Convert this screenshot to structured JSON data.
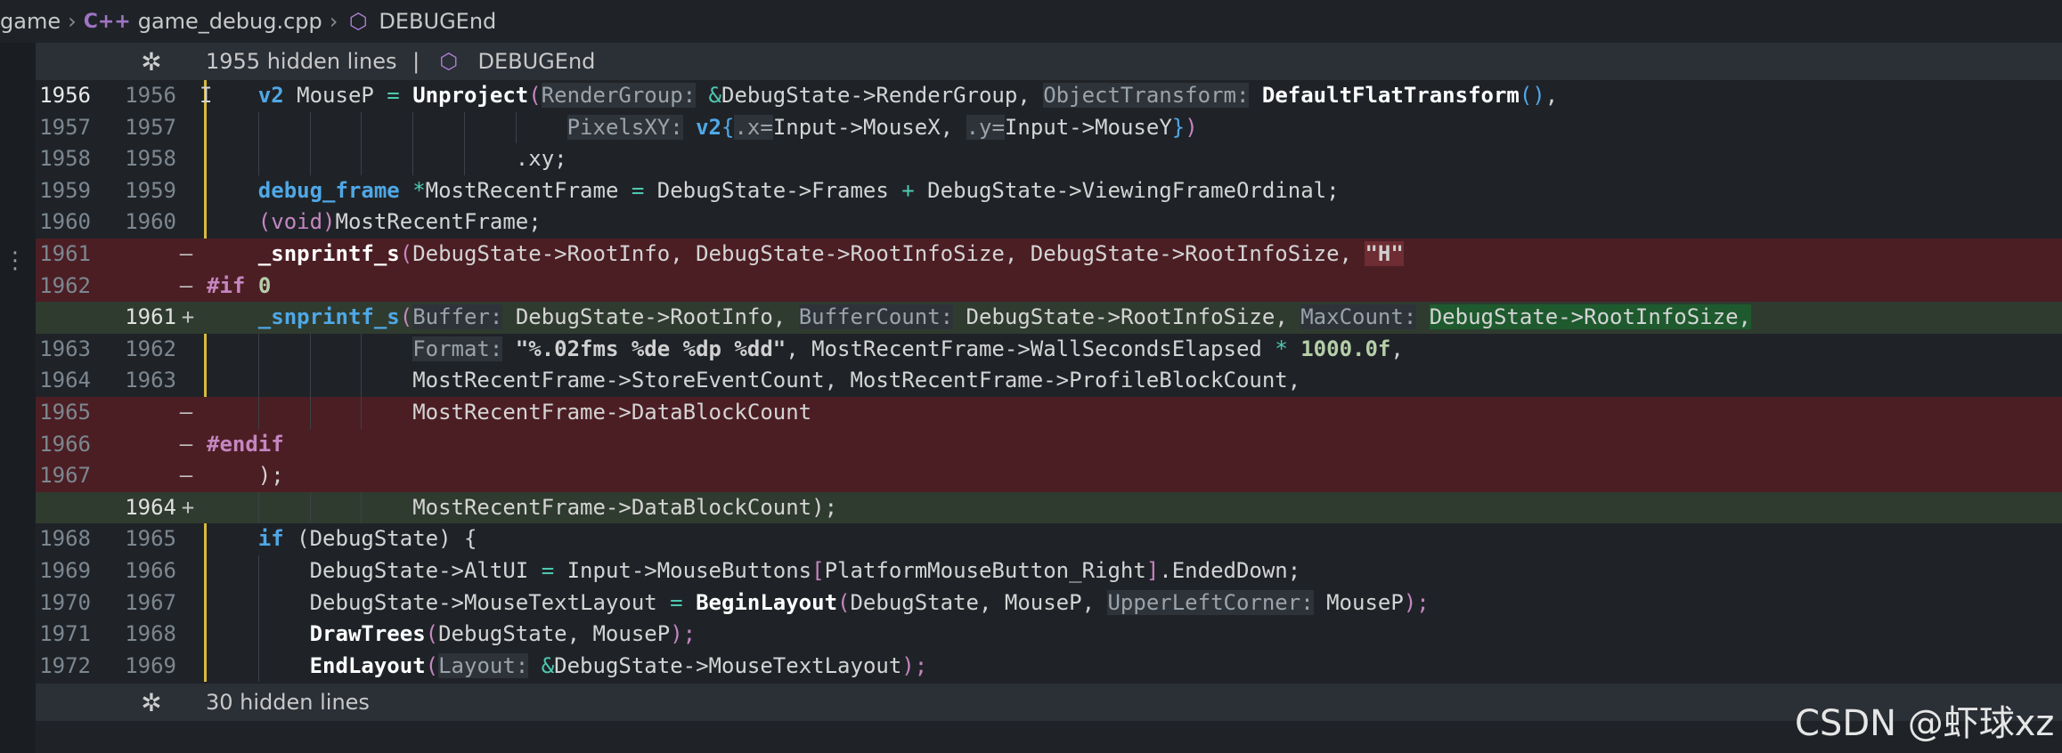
{
  "breadcrumb": {
    "project": "game",
    "file_icon": "C++",
    "file": "game_debug.cpp",
    "symbol": "DEBUGEnd"
  },
  "hidden_top": {
    "count_text": "1955 hidden lines",
    "separator": "|",
    "symbol": "DEBUGEnd"
  },
  "hidden_bottom": {
    "count_text": "30 hidden lines"
  },
  "diff": {
    "line_numbers": [
      {
        "old": "1956",
        "new": "1956",
        "mark": ""
      },
      {
        "old": "1957",
        "new": "1957",
        "mark": ""
      },
      {
        "old": "1958",
        "new": "1958",
        "mark": ""
      },
      {
        "old": "1959",
        "new": "1959",
        "mark": ""
      },
      {
        "old": "1960",
        "new": "1960",
        "mark": ""
      },
      {
        "old": "1961",
        "new": "",
        "mark": "—"
      },
      {
        "old": "1962",
        "new": "",
        "mark": "—"
      },
      {
        "old": "",
        "new": "1961",
        "mark": "+"
      },
      {
        "old": "1963",
        "new": "1962",
        "mark": ""
      },
      {
        "old": "1964",
        "new": "1963",
        "mark": ""
      },
      {
        "old": "1965",
        "new": "",
        "mark": "—"
      },
      {
        "old": "1966",
        "new": "",
        "mark": "—"
      },
      {
        "old": "1967",
        "new": "",
        "mark": "—"
      },
      {
        "old": "",
        "new": "1964",
        "mark": "+"
      },
      {
        "old": "1968",
        "new": "1965",
        "mark": ""
      },
      {
        "old": "1969",
        "new": "1966",
        "mark": ""
      },
      {
        "old": "1970",
        "new": "1967",
        "mark": ""
      },
      {
        "old": "1971",
        "new": "1968",
        "mark": ""
      },
      {
        "old": "1972",
        "new": "1969",
        "mark": ""
      }
    ]
  },
  "tokens": {
    "l0": [
      "v2",
      " MouseP ",
      "=",
      " ",
      "Unproject",
      "(",
      "RenderGroup:",
      " ",
      "&",
      "DebugState->RenderGroup, ",
      "ObjectTransform:",
      " ",
      "DefaultFlatTransform",
      "()",
      ","
    ],
    "l1": [
      "PixelsXY:",
      " ",
      "v2",
      "{",
      ".x=",
      "Input->MouseX, ",
      ".y=",
      "Input->MouseY",
      "}",
      ")"
    ],
    "l2": [
      ".xy;"
    ],
    "l3": [
      "debug_frame",
      " ",
      "*",
      "MostRecentFrame ",
      "=",
      " DebugState->Frames ",
      "+",
      " DebugState->ViewingFrameOrdinal;"
    ],
    "l4": [
      "(",
      "void",
      ")",
      "MostRecentFrame;"
    ],
    "l5": [
      "_snprintf_s",
      "(",
      "DebugState->RootInfo, DebugState->RootInfoSize, DebugState->RootInfoSize, ",
      "\"H\""
    ],
    "l6": [
      "#if",
      " ",
      "0"
    ],
    "l7": [
      "_snprintf_s",
      "(",
      "Buffer:",
      " ",
      "DebugState->RootInfo, ",
      "BufferCount:",
      " ",
      "DebugState->RootInfoSize, ",
      "MaxCount:",
      " ",
      "DebugState->RootInfoSize,"
    ],
    "l8": [
      "Format:",
      " ",
      "\"%.02fms %de %dp %dd\"",
      ", MostRecentFrame->WallSecondsElapsed ",
      "*",
      " ",
      "1000.0f",
      ","
    ],
    "l9": [
      "MostRecentFrame->StoreEventCount, MostRecentFrame->ProfileBlockCount,"
    ],
    "l10": [
      "MostRecentFrame->DataBlockCount"
    ],
    "l11": [
      "#endif"
    ],
    "l12": [
      ");"
    ],
    "l13": [
      "MostRecentFrame->DataBlockCount",
      ");"
    ],
    "l14": [
      "if",
      " (DebugState) {"
    ],
    "l15": [
      "DebugState->AltUI ",
      "=",
      " Input->MouseButtons",
      "[",
      "PlatformMouseButton_Right",
      "]",
      ".EndedDown;"
    ],
    "l16": [
      "DebugState->MouseTextLayout ",
      "=",
      " ",
      "BeginLayout",
      "(",
      "DebugState, MouseP, ",
      "UpperLeftCorner:",
      " ",
      "MouseP",
      ");"
    ],
    "l17": [
      "DrawTrees",
      "(",
      "DebugState, MouseP",
      ");"
    ],
    "l18": [
      "EndLayout",
      "(",
      "Layout:",
      " ",
      "&",
      "DebugState->MouseTextLayout",
      ");"
    ]
  },
  "watermark": "CSDN @虾球xz",
  "colors": {
    "deleted_bg": "#4b1e24",
    "inserted_bg": "#2f3b2f",
    "modified_gutter": "#d7ba3c",
    "keyword": "#4fa8e6",
    "preprocessor": "#c586c0"
  }
}
